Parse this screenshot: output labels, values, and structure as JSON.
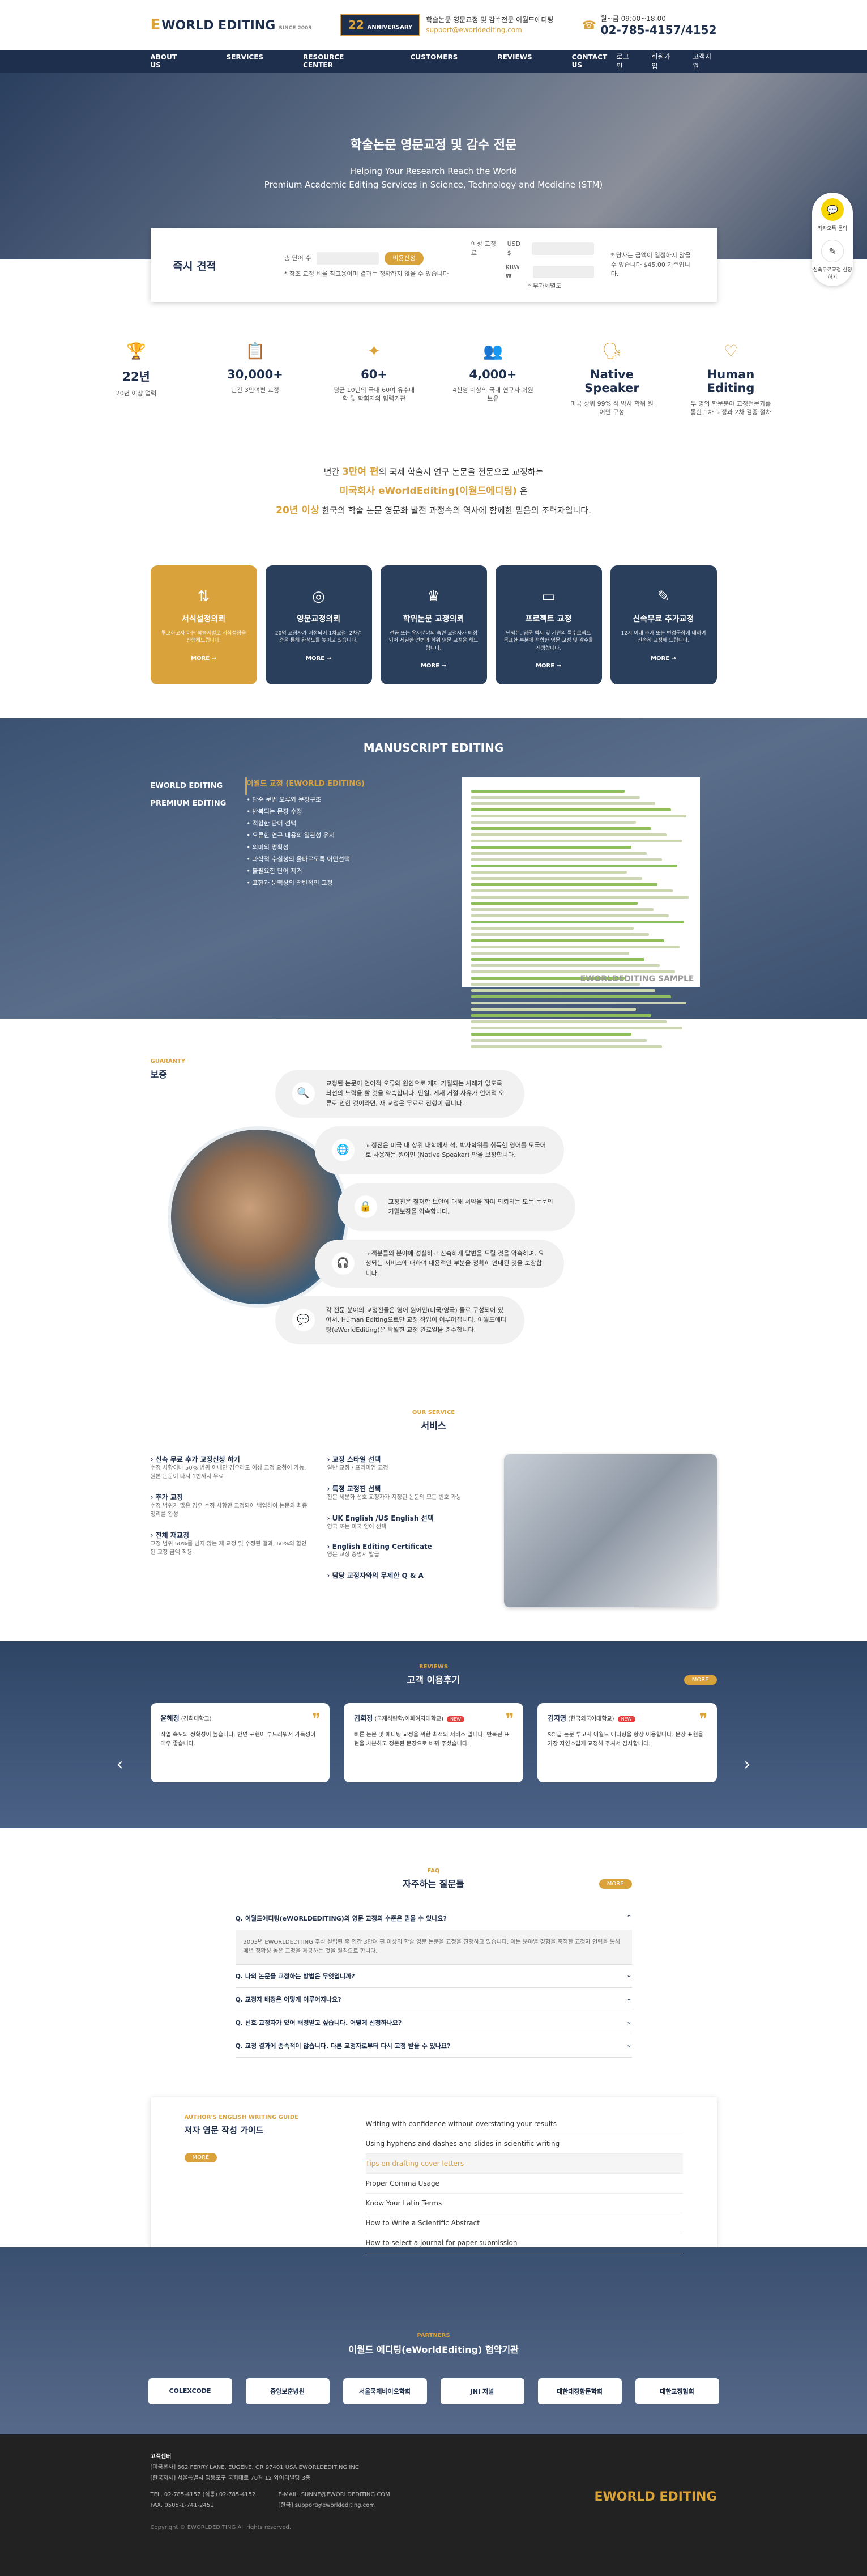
{
  "header": {
    "logo": "WORLD EDITING",
    "logo_e": "E",
    "logo_sub": "SINCE 2003",
    "anniv": "22",
    "anniv_label": "ANNIVERSARY",
    "tagline": "학술논문 영문교정 및 감수전문 이월드에디팅",
    "email": "support@eworldediting.com",
    "hours": "월~금 09:00~18:00",
    "phone": "02-785-4157/4152"
  },
  "nav": {
    "items": [
      "ABOUT US",
      "SERVICES",
      "RESOURCE CENTER",
      "CUSTOMERS",
      "REVIEWS",
      "CONTACT US"
    ],
    "util": [
      "로그인",
      "회원가입",
      "고객지원"
    ]
  },
  "hero": {
    "title": "학술논문 영문교정 및 감수 전문",
    "sub1": "Helping Your Research Reach the World",
    "sub2": "Premium Academic Editing Services in Science, Technology and Medicine (STM)"
  },
  "quote": {
    "title": "즉시 견적",
    "words_label": "총 단어 수",
    "btn": "비용산정",
    "note": "* 참조 교정 비율 참고용이며 결과는 정확하지 않을 수 있습니다",
    "fee_label": "예상 교정료",
    "usd": "USD $",
    "krw": "KRW ₩",
    "vat": "* 부가세별도",
    "right_note": "* 당사는 금액이 일정하지 않을 수 있습니다 $45,00 기준입니다."
  },
  "side": {
    "kakao": "카카오톡 문의",
    "quote": "신속무료교정 신청하기"
  },
  "stats": [
    {
      "big": "22년",
      "sm": "20년 이상 업력"
    },
    {
      "big": "30,000+",
      "sm": "년간 3만여편 교정"
    },
    {
      "big": "60+",
      "sm": "평균 10년의 국내 60여 유수대학 및 학회지의 협력기관"
    },
    {
      "big": "4,000+",
      "sm": "4천명 이상의 국내 연구자 회원 보유"
    },
    {
      "big": "Native Speaker",
      "sm": "미국 상위 99% 석,박사 학위 원어민 구성"
    },
    {
      "big": "Human Editing",
      "sm": "두 명의 학문분야 교정전문가를 통한 1차 교정과 2차 검증 절차"
    }
  ],
  "intro": {
    "l1a": "년간 ",
    "l1g": "3만여 편",
    "l1b": "의 국제 학술지 연구 논문을 전문으로 교정하는",
    "l2": "미국회사 eWorldEditing(이월드에디팅)",
    "l2b": " 은",
    "l3g": "20년 이상",
    "l3": " 한국의 학술 논문 영문화 발전 과정속의 역사에 함께한 믿음의 조력자입니다."
  },
  "cards": [
    {
      "icon": "⇅",
      "title": "서식설정의뢰",
      "desc": "투고하고자 하는 학술지별로 서식설정을 진행해드립니다.",
      "more": "MORE →"
    },
    {
      "icon": "◎",
      "title": "영문교정의뢰",
      "desc": "20명 교정자가 배정되어 1차교정, 2차검증을 통해 완성도를 높이고 있습니다.",
      "more": "MORE →"
    },
    {
      "icon": "♛",
      "title": "학위논문 교정의뢰",
      "desc": "전공 또는 유사분야의 숙련 교정자가 배정되어 세밀한 언변과 학위 영문 교정을 해드립니다.",
      "more": "MORE →"
    },
    {
      "icon": "▭",
      "title": "프로젝트 교정",
      "desc": "단행본, 영문 백서 및 기관의 특수로젝트 목표한 부분에 적합한 영문 교정 및 감수를 진행합니다.",
      "more": "MORE →"
    },
    {
      "icon": "✎",
      "title": "신속무료 추가교정",
      "desc": "12시 이내 추가 또는 변경문장에 대하여 신속히 교정해 드립니다.",
      "more": "MORE →"
    }
  ],
  "manu": {
    "title": "MANUSCRIPT EDITING",
    "left": [
      "EWORLD EDITING",
      "PREMIUM EDITING"
    ],
    "mtitle": "이월드 교정 (EWORLD EDITING)",
    "items": [
      "단순 문법 오류와 문장구조",
      "반복되는 문장 수정",
      "적합한 단어 선택",
      "오류한 연구 내용의 일관성 유지",
      "의미의 명확성",
      "과학적 수실성의 올바르도록 어떤선택",
      "불필요한 단어 제거",
      "표현과 문맥상의 전반적인 교정"
    ],
    "sample": "EWORLDEDITING SAMPLE"
  },
  "guar": {
    "en": "GUARANTY",
    "ko": "보증",
    "pills": [
      "교정된 논문이 언어적 오류와 원인으로 게재 거절되는 사례가 없도록 최선의 노력을 할 것을 약속합니다. 만일, 게재 거절 사유가 언어적 오류로 인한 것이라면, 재 교정은 무료로 진행이 됩니다.",
      "교정진은 미국 내 상위 대학에서 석, 박사학위를 취득한 영어를 모국어로 사용하는 원어민 (Native Speaker) 만을 보장합니다.",
      "교정진은 철저한 보안에 대해 서약을 하여 의뢰되는 모든 논문의 기밀보장을 약속합니다.",
      "고객분들의 분야에 성실하고 신속하게 답변을 드릴 것을 약속하며, 요청되는 서비스에 대하여 내용적인 부분을 정확히 안내된 것을 보장합니다.",
      "각 전문 분야의 교정진들은 영어 원어민(미국/영국) 들로 구성되어 있어서, Human Editing으로만 교정 작업이 이루어집니다. 이월드에디팅(eWorldEditing)은 탁월한 교정 완료일을 준수합니다."
    ]
  },
  "serv": {
    "en": "OUR SERVICE",
    "ko": "서비스",
    "col1": [
      {
        "t": "신속 무료 추가 교정신청 하기",
        "d": "수정 사항이나 50% 범위 이내인 경우라도 이상 교정 요청이 가능. 원본 논문이 다시 1번까지 무료"
      },
      {
        "t": "추가 교정",
        "d": "수정 범위가 많은 경우 수정 사항만 교정되어 백업하여 논문의 최종 정리를 완성"
      },
      {
        "t": "전체 재교정",
        "d": "교정 범위 50%를 넘지 않는 재 교정 및 수정된 결과, 60%의 할인된 교정 금액 적용"
      }
    ],
    "col2": [
      {
        "t": "교정 스타일 선택",
        "d": "일반 교정 / 프리미엄 교정"
      },
      {
        "t": "특정 교정진 선택",
        "d": "전문 세분화 선호 교정자가 지정된 논문의 모든 번호 가능"
      },
      {
        "t": "UK English /US English 선택",
        "d": "영국 또는 미국 영어 선택"
      },
      {
        "t": "English Editing Certificate",
        "d": "영문 교정 증명서 발급"
      },
      {
        "t": "담당 교정자와의 무제한 Q & A",
        "d": ""
      }
    ]
  },
  "rev": {
    "en": "REVIEWS",
    "ko": "고객 이용후기",
    "more": "MORE",
    "items": [
      {
        "name": "윤혜정",
        "role": "(경희대학교)",
        "new": "",
        "text": "작업 속도와 정확성이 높습니다. 반면 표현이 부드러워서 가독성이 매우 좋습니다."
      },
      {
        "name": "김희정",
        "role": "(국제식량학/이화여자대학교)",
        "new": "NEW",
        "text": "빠른 논문 및 에디팅 교정을 위한 최적의 서비스 입니다. 반복된 표현을 차분하고 정돈된 문장으로 바꿔 주셨습니다."
      },
      {
        "name": "김지영",
        "role": "(한국외국어대학교)",
        "new": "NEW",
        "text": "SCI급 논문 투고시 이월드 에디팅을 항상 이용합니다. 문장 표현을 가장 자연스럽게 교정해 주셔서 감사합니다."
      }
    ]
  },
  "faq": {
    "en": "FAQ",
    "ko": "자주하는 질문들",
    "more": "MORE",
    "q": [
      "Q. 이월드에디팅(eWORLDEDITING)의 영문 교정의 수준은 믿을 수 있나요?",
      "Q. 나의 논문을 교정하는 방법은 무엇입니까?",
      "Q. 교정자 배정은 어떻게 이루어지나요?",
      "Q. 선호 교정자가 있어 배정받고 싶습니다. 어떻게 신청하나요?",
      "Q. 교정 결과에 종속적이 않습니다. 다른 교정자로부터 다시 교정 받을 수 있나요?"
    ],
    "ans": "2003년 EWORLDEDITING 주식 설립된 후 연간 3만여 편 이상의 학술 영문 논문을 교정을 진행하고 있습니다. 이는 분야별 경험을 축적한 교정자 인력을 통해 매년 정확성 높은 교정을 제공하는 것을 원칙으로 합니다."
  },
  "guide": {
    "en": "AUTHOR'S ENGLISH WRITING GUIDE",
    "ko": "저자 영문 작성 가이드",
    "more": "MORE",
    "items": [
      "Writing with confidence without overstating your results",
      "Using hyphens and dashes and slides in scientific writing",
      "Tips on drafting cover letters",
      "Proper Comma Usage",
      "Know Your Latin Terms",
      "How to Write a Scientific Abstract",
      "How to select a journal for paper submission"
    ]
  },
  "partners": {
    "en": "PARTNERS",
    "ko": "이월드 에디팅(eWorldEditing) 협약기관",
    "logos": [
      "COLEXCODE",
      "중앙보훈병원",
      "서울국제바이오학회",
      "JNI 저널",
      "대한대장항문학회",
      "대한교정협회"
    ]
  },
  "footer": {
    "title": "고객센터",
    "addr1": "[미국본사] 862 FERRY LANE, EUGENE, OR 97401 USA EWORLDEDITING INC",
    "addr2": "[한국지사] 서울특별시 영등포구 국회대로 70길 12 와이디빌딩 3층",
    "tel": "TEL. 02-785-4157 (직통) 02-785-4152",
    "fax": "FAX. 0505-1-741-2451",
    "email_en": "E-MAIL. SUNNE@EWORLDEDITING.COM",
    "email_kr": "[한국] support@eworldediting.com",
    "copy": "Copyright © EWORLDEDITING All rights reserved.",
    "logo": "EWORLD EDITING"
  }
}
